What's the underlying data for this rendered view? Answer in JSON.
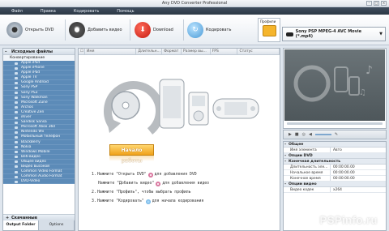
{
  "window": {
    "title": "Any DVD Converter Professional"
  },
  "menu": {
    "items": [
      "Файл",
      "Правка",
      "Кодировать",
      "Помощь"
    ]
  },
  "toolbar": {
    "open_dvd": "Открыть DVD",
    "add_video": "Добавить видео",
    "download": "Download",
    "encode": "Кодировать",
    "profiles_label": "Профили",
    "profile_value": "Sony PSP MPEG-4 AVC Movie (*.mp4)"
  },
  "sidebar": {
    "root_title": "Исходные файлы",
    "section_title": "Конвертирование",
    "items": [
      "Apple iPod",
      "Apple iPhone",
      "Apple iPad",
      "Apple TV",
      "Google Android",
      "Sony PSP",
      "Sony PS3",
      "Sony Walkman",
      "Microsoft Zune",
      "Archos",
      "Creative Zen",
      "iRiver",
      "Sandisk Sansa",
      "Microsoft Xbox 360",
      "Nintendo Wii",
      "Мобильный телефон",
      "BlackBerry",
      "Nokia",
      "Windows Mobile",
      "Веб-видео",
      "Общее видео",
      "Видео высокой",
      "Common Video Format",
      "Common Audio Format",
      "DVD-Video"
    ],
    "bottom_title": "Скачанные",
    "tabs": [
      "Output Folder",
      "Options"
    ]
  },
  "list": {
    "columns": [
      "Имя",
      "Длительн...",
      "Формат",
      "Размер вы...",
      "FPS",
      "Статус"
    ]
  },
  "center": {
    "start_button": "Начало работы",
    "steps": [
      {
        "num": "1.",
        "pre": "Нажмите \"Открыть DVD\"",
        "post": "для добавления DVD"
      },
      {
        "num": "",
        "pre": "Нажмите \"Добавить видео\"",
        "post": "для добавления видео"
      },
      {
        "num": "2.",
        "pre": "Нажмите \"Профиль\", чтобы выбрать профиль",
        "post": ""
      },
      {
        "num": "3.",
        "pre": "Нажмите \"Кодировать\"",
        "post": "для начала кодирования"
      }
    ]
  },
  "properties": {
    "general_title": "Общее",
    "rows_general": [
      {
        "k": "Имя элемента",
        "v": "Авто"
      }
    ],
    "video_opts_title": "Опции DVD",
    "duration_title": "Конечная длительность",
    "rows_duration": [
      {
        "k": "Длительность эле...",
        "v": "00:00:00.00"
      },
      {
        "k": "Начальное время",
        "v": "00:00:00.00"
      },
      {
        "k": "Конечное время",
        "v": "00:00:00.00"
      }
    ],
    "video_title": "Опции видео",
    "rows_video": [
      {
        "k": "Видео кодек",
        "v": "x264"
      }
    ]
  },
  "watermark": "PSPinfo.ru",
  "colors": {
    "accent": "#f0a21a",
    "sidebar": "#5c8bb8",
    "menubar": "#2c3845"
  }
}
